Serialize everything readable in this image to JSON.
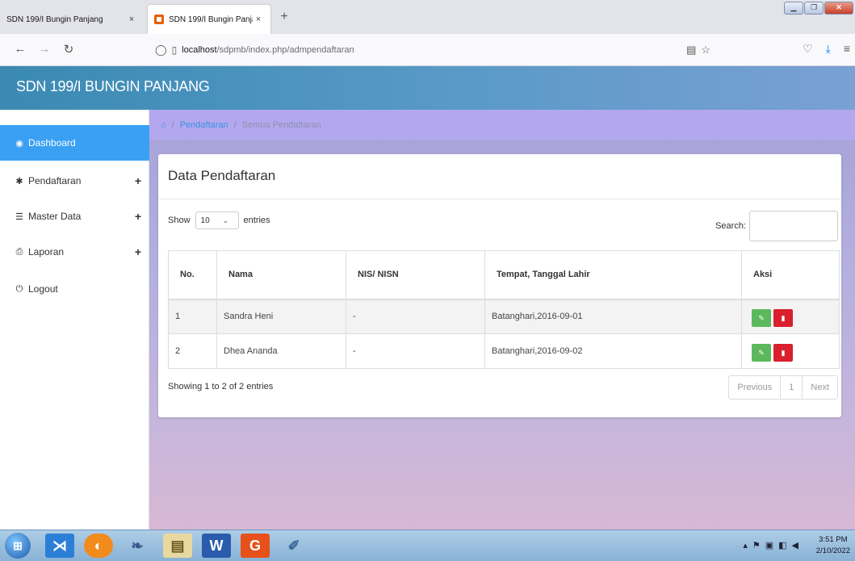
{
  "browser": {
    "tabs": [
      {
        "title": "SDN 199/I Bungin Panjang",
        "close": "×"
      },
      {
        "title": "SDN 199/I Bungin Panjang",
        "close": "×"
      }
    ],
    "new_tab": "+",
    "url_host": "localhost",
    "url_path": "/sdpmb/index.php/admpendaftaran"
  },
  "app": {
    "brand": "SDN 199/I BUNGIN PANJANG"
  },
  "sidebar": {
    "items": [
      {
        "label": "Dashboard",
        "icon": "dashboard-icon",
        "expandable": false
      },
      {
        "label": "Pendaftaran",
        "icon": "gear-icon",
        "expandable": true
      },
      {
        "label": "Master Data",
        "icon": "database-icon",
        "expandable": true
      },
      {
        "label": "Laporan",
        "icon": "print-icon",
        "expandable": true
      },
      {
        "label": "Logout",
        "icon": "power-icon",
        "expandable": false
      }
    ],
    "plus": "+"
  },
  "breadcrumb": {
    "sep": "/",
    "link": "Pendaftaran",
    "current": "Semua Pendaftaran"
  },
  "panel": {
    "title": "Data Pendaftaran",
    "show_label": "Show",
    "entries_value": "10",
    "entries_label": "entries",
    "search_label": "Search:",
    "info": "Showing 1 to 2 of 2 entries",
    "pager": {
      "previous": "Previous",
      "page": "1",
      "next": "Next"
    }
  },
  "table": {
    "headers": [
      "No.",
      "Nama",
      "NIS/ NISN",
      "Tempat, Tanggal Lahir",
      "Aksi"
    ],
    "rows": [
      {
        "no": "1",
        "nama": "Sandra Heni",
        "nis": "-",
        "ttl": "Batanghari,2016-09-01"
      },
      {
        "no": "2",
        "nama": "Dhea Ananda",
        "nis": "-",
        "ttl": "Batanghari,2016-09-02"
      }
    ]
  },
  "taskbar": {
    "time": "3:51 PM",
    "date": "2/10/2022"
  },
  "colors": {
    "sidebar_active": "#3aa0f3",
    "edit_button": "#5cb85c",
    "delete_button": "#d9202c",
    "breadcrumb_bar": "#b3a8ef"
  }
}
